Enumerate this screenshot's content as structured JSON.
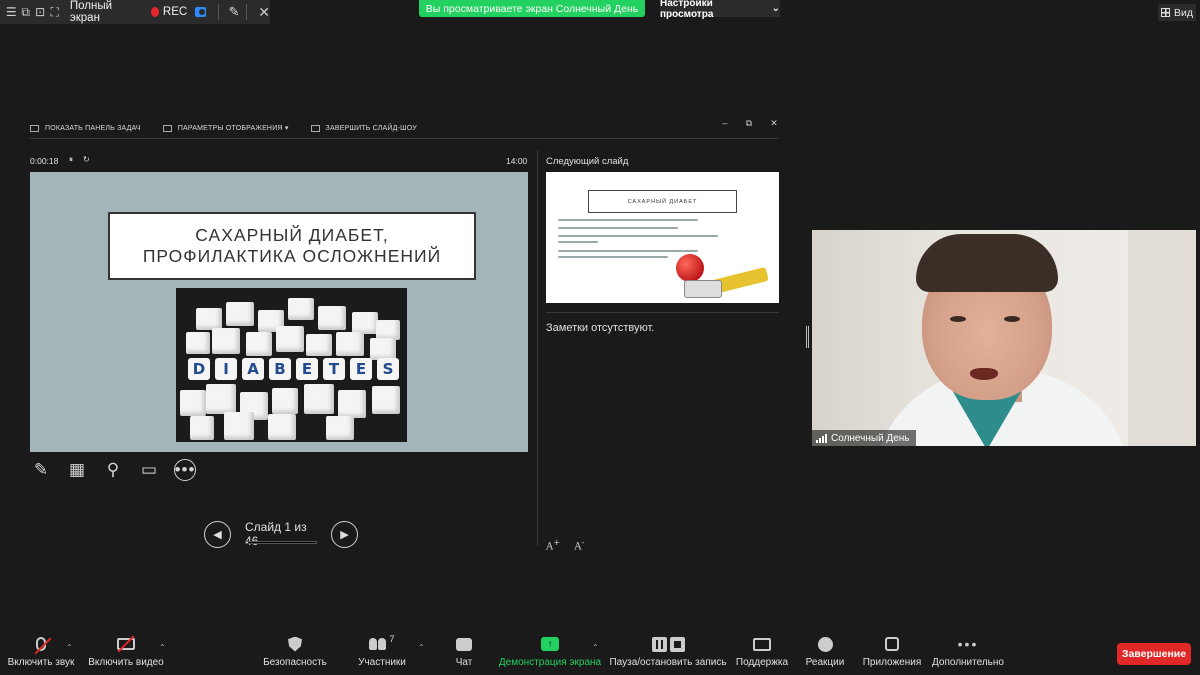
{
  "topbar": {
    "fullscreen_label": "Полный экран",
    "rec_label": "REC",
    "viewing_banner": "Вы просматриваете экран Солнечный День",
    "view_settings": "Настройки просмотра",
    "view_button": "Вид"
  },
  "presenter": {
    "toolbar": {
      "show_taskbar": "ПОКАЗАТЬ ПАНЕЛЬ ЗАДАЧ",
      "display_settings": "ПАРАМЕТРЫ ОТОБРАЖЕНИЯ ▾",
      "end_show": "ЗАВЕРШИТЬ СЛАЙД-ШОУ"
    },
    "timer": "0:00:18",
    "clock": "14:00",
    "slide": {
      "title_line1": "САХАРНЫЙ ДИАБЕТ,",
      "title_line2": "ПРОФИЛАКТИКА ОСЛОЖНЕНИЙ",
      "dice_letters": [
        "D",
        "I",
        "A",
        "B",
        "E",
        "T",
        "E",
        "S"
      ],
      "background": "#a3b5b8"
    },
    "navigation": {
      "counter": "Слайд 1 из 46",
      "progress": 0.022
    },
    "next_slide_label": "Следующий слайд",
    "next_slide_title": "САХАРНЫЙ ДИАБЕТ",
    "notes": "Заметки отсутствуют."
  },
  "participant": {
    "name": "Солнечный День"
  },
  "bottombar": {
    "unmute": "Включить звук",
    "start_video": "Включить видео",
    "security": "Безопасность",
    "participants": "Участники",
    "participants_count": "7",
    "chat": "Чат",
    "share": "Демонстрация экрана",
    "pause_record": "Пауза/остановить запись",
    "support": "Поддержка",
    "reactions": "Реакции",
    "apps": "Приложения",
    "more": "Дополнительно",
    "end": "Завершение"
  },
  "colors": {
    "share_green": "#23d160",
    "end_red": "#e02828",
    "rec_red": "#e8262d",
    "camera_blue": "#2d8cff"
  }
}
